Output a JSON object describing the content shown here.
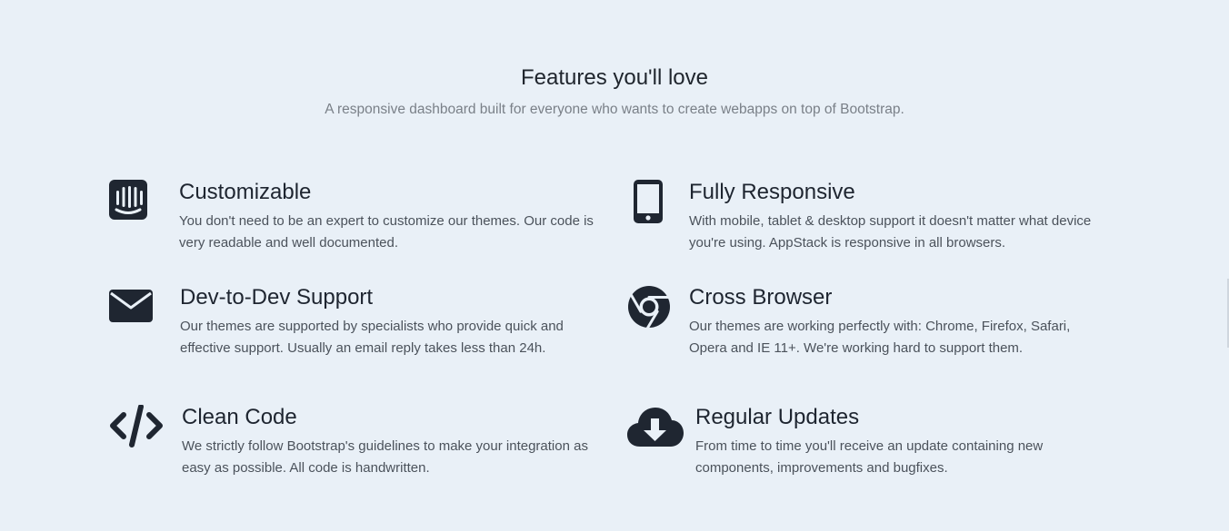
{
  "section": {
    "title": "Features you'll love",
    "subtitle": "A responsive dashboard built for everyone who wants to create webapps on top of Bootstrap."
  },
  "features": [
    {
      "icon": "intercom-icon",
      "title": "Customizable",
      "description": "You don't need to be an expert to customize our themes. Our code is very readable and well documented."
    },
    {
      "icon": "mobile-phone-icon",
      "title": "Fully Responsive",
      "description": "With mobile, tablet & desktop support it doesn't matter what device you're using. AppStack is responsive in all browsers."
    },
    {
      "icon": "envelope-icon",
      "title": "Dev-to-Dev Support",
      "description": "Our themes are supported by specialists who provide quick and effective support. Usually an email reply takes less than 24h."
    },
    {
      "icon": "chrome-icon",
      "title": "Cross Browser",
      "description": "Our themes are working perfectly with: Chrome, Firefox, Safari, Opera and IE 11+. We're working hard to support them."
    },
    {
      "icon": "code-icon",
      "title": "Clean Code",
      "description": "We strictly follow Bootstrap's guidelines to make your integration as easy as possible. All code is handwritten."
    },
    {
      "icon": "cloud-download-icon",
      "title": "Regular Updates",
      "description": "From time to time you'll receive an update containing new components, improvements and bugfixes."
    }
  ],
  "colors": {
    "background": "#e9f0f7",
    "icon": "#1f2631",
    "heading": "#1e2530",
    "body_text": "#4b525b",
    "muted": "#7a8088"
  }
}
